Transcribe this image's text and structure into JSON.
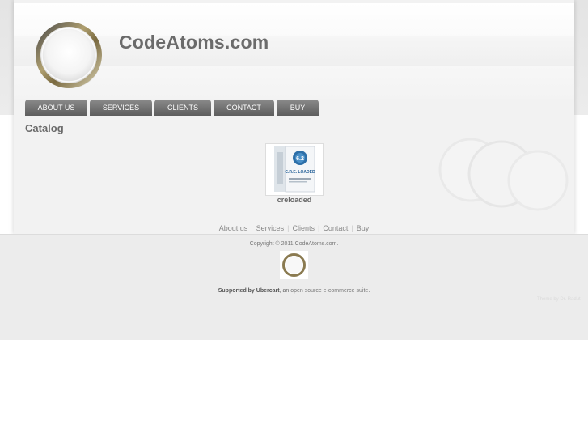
{
  "header": {
    "site_name": "CodeAtoms.com"
  },
  "nav": {
    "tabs": [
      {
        "label": "ABOUT US"
      },
      {
        "label": "SERVICES"
      },
      {
        "label": "CLIENTS"
      },
      {
        "label": "CONTACT"
      },
      {
        "label": "BUY"
      }
    ]
  },
  "main": {
    "title": "Catalog",
    "product": {
      "image_label": "C.R.E. LOADED",
      "image_badge": "6.2",
      "name": "creloaded"
    }
  },
  "footer": {
    "links": [
      "About us",
      "Services",
      "Clients",
      "Contact",
      "Buy"
    ],
    "copyright": "Copyright © 2011 CodeAtoms.com.",
    "supported_bold": "Supported by Ubercart",
    "supported_comma": ", an ",
    "supported_link": "open source e-commerce suite",
    "supported_end": ".",
    "theme_credit": "Theme by Dr. Radut"
  }
}
